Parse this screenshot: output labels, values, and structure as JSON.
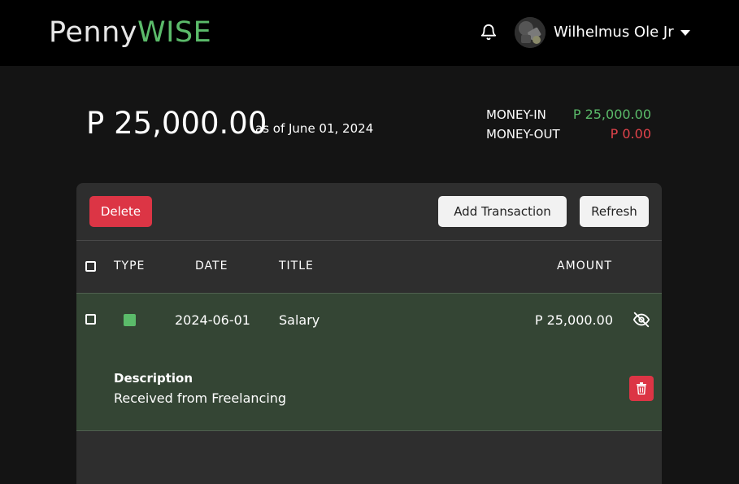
{
  "brand": {
    "part1": "Penny",
    "part2": "WISE"
  },
  "header": {
    "username": "Wilhelmus Ole Jr",
    "bell_icon": "bell-icon",
    "caret_icon": "caret-down-icon"
  },
  "summary": {
    "balance": "P 25,000.00",
    "as_of": "as of June 01, 2024",
    "money_in_label": "MONEY-IN",
    "money_in_value": "P 25,000.00",
    "money_out_label": "MONEY-OUT",
    "money_out_value": "P 0.00"
  },
  "toolbar": {
    "delete_label": "Delete",
    "add_label": "Add Transaction",
    "refresh_label": "Refresh"
  },
  "table": {
    "headers": {
      "type": "TYPE",
      "date": "DATE",
      "title": "TITLE",
      "amount": "AMOUNT"
    },
    "rows": [
      {
        "type_color": "#5bbb6a",
        "date": "2024-06-01",
        "title": "Salary",
        "amount": "P 25,000.00",
        "description_label": "Description",
        "description": "Received from Freelancing"
      }
    ]
  },
  "colors": {
    "accent_green": "#5bbb6a",
    "danger_red": "#dc3545",
    "row_expanded_bg": "#344534"
  }
}
